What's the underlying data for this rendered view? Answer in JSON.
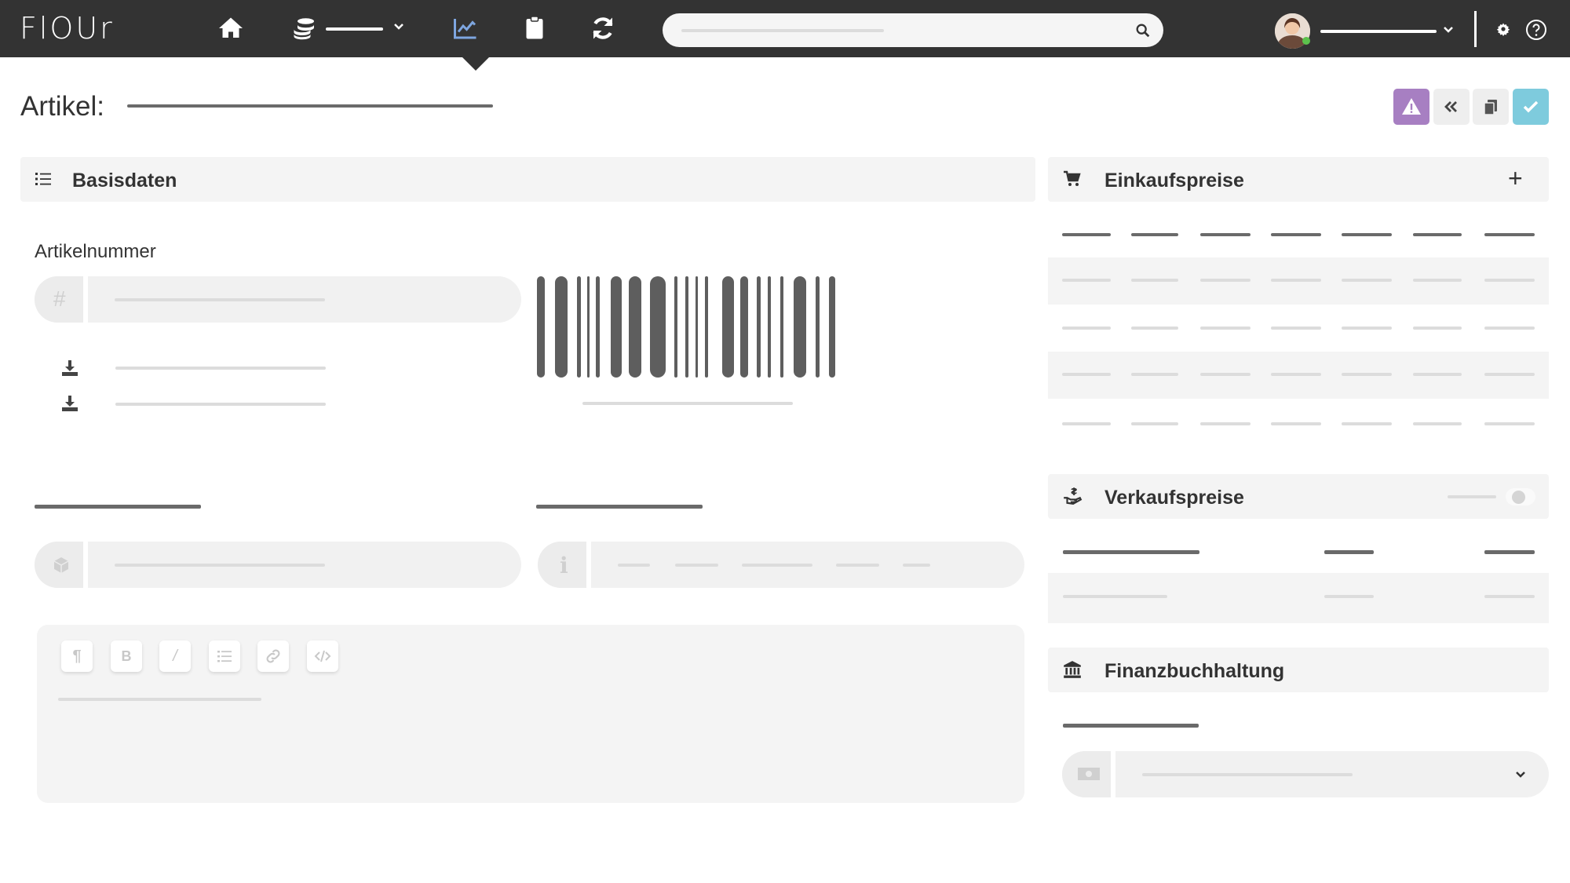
{
  "app": {
    "logo": "FlOUr"
  },
  "nav": {
    "icons": [
      "home-icon",
      "coins-icon",
      "chart-line-icon",
      "clipboard-icon",
      "sync-icon"
    ],
    "active": "chart-line-icon",
    "search": {
      "placeholder": ""
    }
  },
  "page": {
    "title": "Artikel:"
  },
  "actions": [
    "warning-icon",
    "double-chevron-left-icon",
    "copy-icon",
    "check-icon"
  ],
  "colors": {
    "nav_bg": "#333333",
    "active_icon": "#7ea6e0",
    "warn_btn": "#a77fc2",
    "ok_btn": "#7ecbdd",
    "panel_bg": "#f4f4f4"
  },
  "basisdaten": {
    "title": "Basisdaten",
    "artikelnummer_label": "Artikelnummer",
    "artikelnummer_icon": "#",
    "info_icon": "i"
  },
  "einkaufspreise": {
    "title": "Einkaufspreise",
    "add": "+"
  },
  "verkaufspreise": {
    "title": "Verkaufspreise"
  },
  "finanzbuchhaltung": {
    "title": "Finanzbuchhaltung"
  },
  "editor": {
    "toolbar": [
      "¶",
      "B",
      "/",
      "list-icon",
      "link-icon",
      "code-icon"
    ]
  }
}
